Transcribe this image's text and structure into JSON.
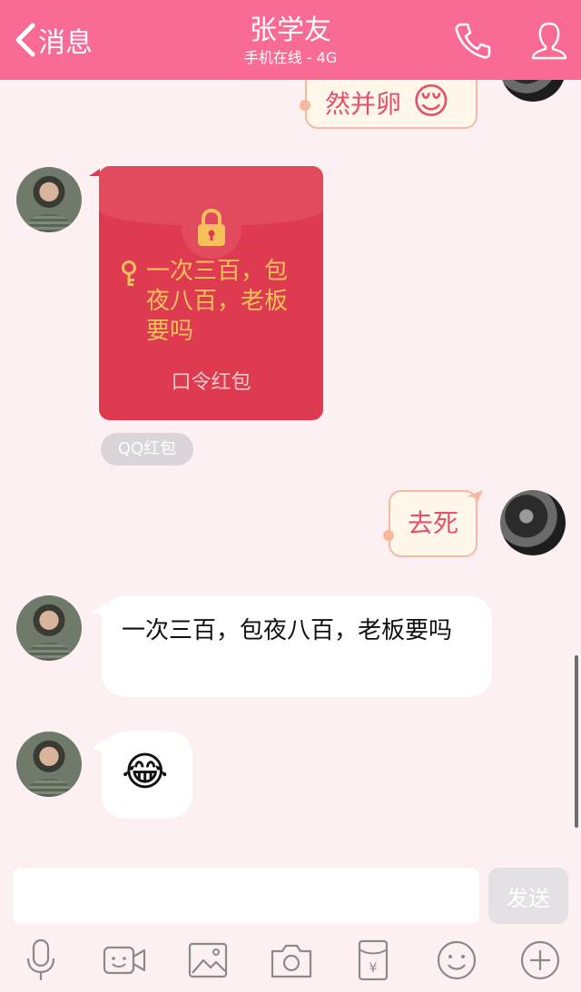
{
  "header": {
    "back_label": "消息",
    "contact_name": "张学友",
    "status": "手机在线 - 4G"
  },
  "messages": {
    "partial_self_text": "然并卵",
    "red_packet": {
      "text": "一次三百，包夜八百，老板要吗",
      "label": "口令红包",
      "tag": "QQ红包"
    },
    "self_reply": "去死",
    "contact_text": "一次三百，包夜八百，老板要吗",
    "contact_emoji": "😂",
    "partial_emoji": "😌"
  },
  "composer": {
    "input_value": "",
    "send_label": "发送"
  },
  "colors": {
    "accent": "#f96b95",
    "red_packet": "#de3b51",
    "packet_text": "#f6c05a"
  }
}
